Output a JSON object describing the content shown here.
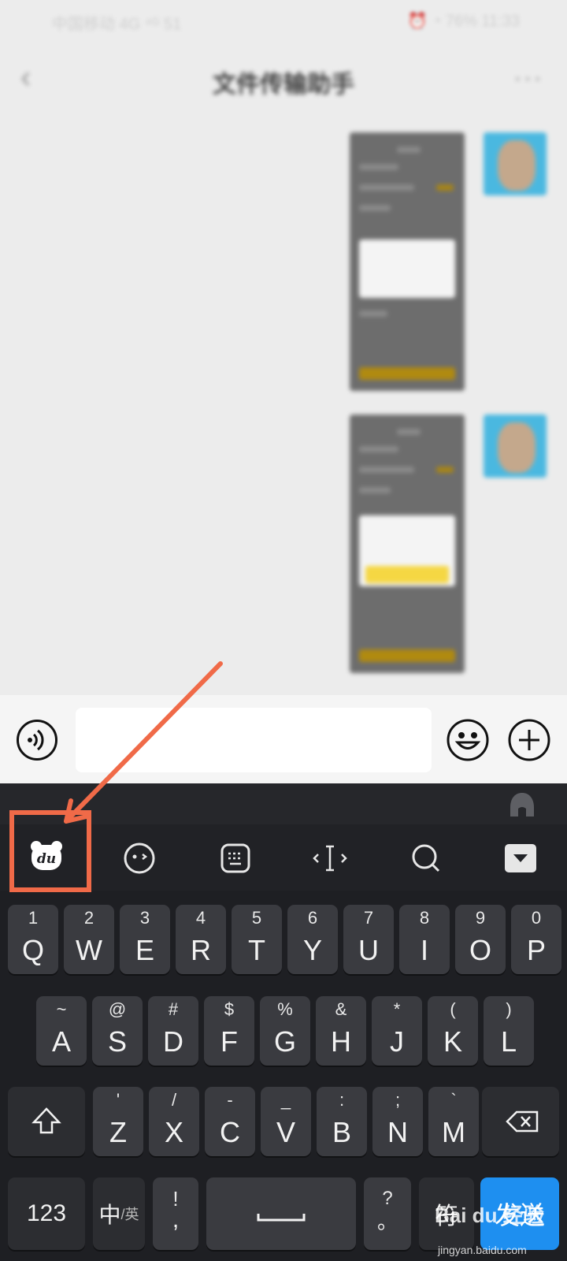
{
  "status_bar": {
    "left": "中国移动 4G ⁴ᴳ 51",
    "right": "⏰ ◔ 76% 11:33"
  },
  "header": {
    "title": "文件传输助手",
    "back_icon": "chevron-left-icon",
    "more_icon": "more-dots-icon"
  },
  "input_bar": {
    "voice_icon": "voice-icon",
    "emoji_icon": "emoji-icon",
    "plus_icon": "plus-icon",
    "input_value": ""
  },
  "keyboard": {
    "toolbar": [
      "du-bear-icon",
      "emoji-face-icon",
      "keyboard-layout-icon",
      "cursor-icon",
      "search-icon",
      "hide-keyboard-icon"
    ],
    "row1": [
      {
        "main": "Q",
        "sub": "1"
      },
      {
        "main": "W",
        "sub": "2"
      },
      {
        "main": "E",
        "sub": "3"
      },
      {
        "main": "R",
        "sub": "4"
      },
      {
        "main": "T",
        "sub": "5"
      },
      {
        "main": "Y",
        "sub": "6"
      },
      {
        "main": "U",
        "sub": "7"
      },
      {
        "main": "I",
        "sub": "8"
      },
      {
        "main": "O",
        "sub": "9"
      },
      {
        "main": "P",
        "sub": "0"
      }
    ],
    "row2": [
      {
        "main": "A",
        "sub": "~"
      },
      {
        "main": "S",
        "sub": "@"
      },
      {
        "main": "D",
        "sub": "#"
      },
      {
        "main": "F",
        "sub": "$"
      },
      {
        "main": "G",
        "sub": "%"
      },
      {
        "main": "H",
        "sub": "&"
      },
      {
        "main": "J",
        "sub": "*"
      },
      {
        "main": "K",
        "sub": "("
      },
      {
        "main": "L",
        "sub": ")"
      }
    ],
    "row3": [
      {
        "main": "Z",
        "sub": "'"
      },
      {
        "main": "X",
        "sub": "/"
      },
      {
        "main": "C",
        "sub": "-"
      },
      {
        "main": "V",
        "sub": "_"
      },
      {
        "main": "B",
        "sub": ":"
      },
      {
        "main": "N",
        "sub": ";"
      },
      {
        "main": "M",
        "sub": "`"
      }
    ],
    "bottom": {
      "num": "123",
      "lang_main": "中",
      "lang_sub": "/英",
      "punct_top": "!",
      "punct_bottom": ",",
      "q_top": "?",
      "q_bottom": "。",
      "fu": "符",
      "send": "发送"
    }
  },
  "watermark": {
    "text": "Bai du 经验",
    "url": "jingyan.baidu.com"
  },
  "colors": {
    "send": "#1e8ff0",
    "annotation": "#f06a48",
    "keyboard_bg": "#1e1f23",
    "key": "#3a3b40"
  }
}
